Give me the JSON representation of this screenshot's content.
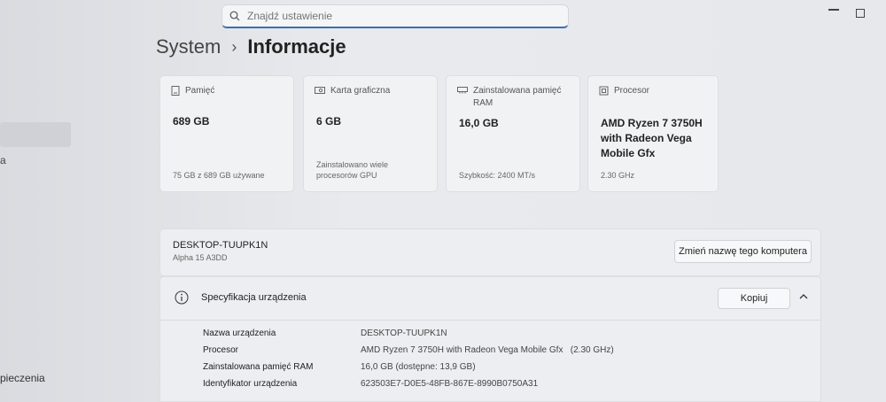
{
  "search": {
    "placeholder": "Znajdź ustawienie"
  },
  "sidebar": {
    "fragment_a": "a",
    "fragment_bezpieczenstwo": "pieczenia"
  },
  "breadcrumb": {
    "parent": "System",
    "separator": "›",
    "current": "Informacje"
  },
  "cards": [
    {
      "label": "Pamięć",
      "value": "689 GB",
      "sub": "75 GB z 689 GB używane",
      "icon": "storage-icon"
    },
    {
      "label": "Karta graficzna",
      "value": "6 GB",
      "sub": "Zainstalowano wiele procesorów GPU",
      "icon": "gpu-icon"
    },
    {
      "label": "Zainstalowana pamięć RAM",
      "value": "16,0 GB",
      "sub": "Szybkość: 2400 MT/s",
      "icon": "ram-icon"
    },
    {
      "label": "Procesor",
      "value": "AMD Ryzen 7 3750H with Radeon Vega Mobile Gfx",
      "sub": "2.30 GHz",
      "icon": "processor-icon"
    }
  ],
  "device": {
    "name": "DESKTOP-TUUPK1N",
    "model": "Alpha 15 A3DD",
    "rename_button": "Zmień nazwę tego komputera"
  },
  "spec": {
    "title": "Specyfikacja urządzenia",
    "copy_button": "Kopiuj",
    "rows": [
      {
        "label": "Nazwa urządzenia",
        "value": "DESKTOP-TUUPK1N"
      },
      {
        "label": "Procesor",
        "value": "AMD Ryzen 7 3750H with Radeon Vega Mobile Gfx   (2.30 GHz)"
      },
      {
        "label": "Zainstalowana pamięć RAM",
        "value": "16,0 GB (dostępne: 13,9 GB)"
      },
      {
        "label": "Identyfikator urządzenia",
        "value": "623503E7-D0E5-48FB-867E-8990B0750A31"
      }
    ]
  }
}
